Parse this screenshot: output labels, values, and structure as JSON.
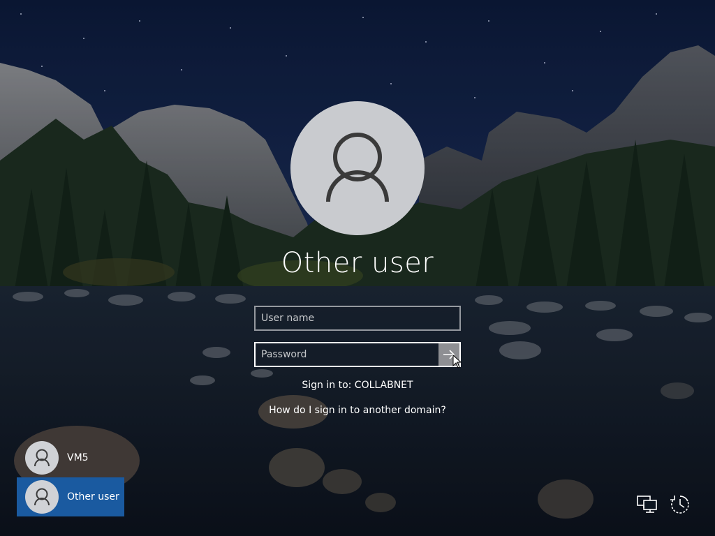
{
  "login": {
    "user_title": "Other user",
    "username_placeholder": "User name",
    "password_placeholder": "Password",
    "sign_in_to": "Sign in to: COLLABNET",
    "help_link": "How do I sign in to another domain?",
    "submit_icon": "arrow-right-icon"
  },
  "user_list": [
    {
      "label": "VM5",
      "selected": false
    },
    {
      "label": "Other user",
      "selected": true
    }
  ],
  "tray": {
    "network_icon": "network-icon",
    "accessibility_icon": "ease-of-access-icon"
  },
  "colors": {
    "selected_tile": "#1a5aa0",
    "avatar_bg": "#c9cbcf",
    "submit_button": "#8e8f93"
  }
}
